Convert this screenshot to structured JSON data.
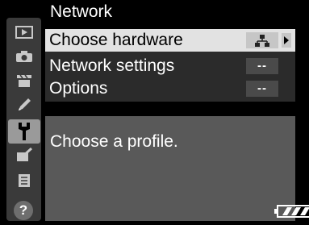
{
  "header": {
    "title": "Network"
  },
  "sidebar": {
    "tabs": [
      {
        "icon": "playback-icon"
      },
      {
        "icon": "camera-icon"
      },
      {
        "icon": "movie-icon"
      },
      {
        "icon": "pencil-icon"
      },
      {
        "icon": "wrench-icon",
        "active": true
      },
      {
        "icon": "retouch-icon"
      },
      {
        "icon": "my-menu-icon"
      }
    ],
    "help_label": "?"
  },
  "menu": {
    "items": [
      {
        "label": "Choose hardware",
        "value_icon": "network-hardware-icon",
        "selected": true
      },
      {
        "label": "Network settings",
        "value": "--"
      },
      {
        "label": "Options",
        "value": "--"
      }
    ]
  },
  "help": {
    "text": "Choose a profile."
  },
  "status": {
    "battery_icon": "battery-full-icon"
  },
  "colors": {
    "selected_bg": "#e2e2e2",
    "panel_bg": "#2b2b2b",
    "help_bg": "#595959",
    "sidebar_bg": "#3a3a3a"
  }
}
